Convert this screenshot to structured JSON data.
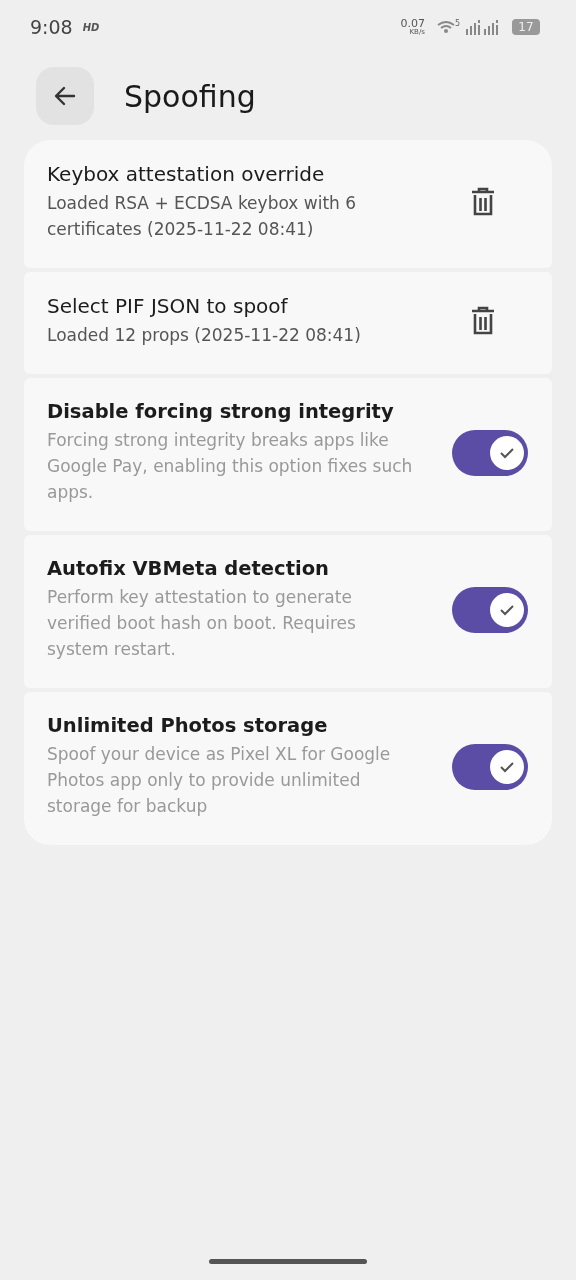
{
  "status_bar": {
    "time": "9:08",
    "hd": "HD",
    "speed": "0.07",
    "speed_unit": "KB/s",
    "wifi_band": "5",
    "battery": "17"
  },
  "header": {
    "title": "Spoofing"
  },
  "items": [
    {
      "kind": "file",
      "title": "Keybox attestation override",
      "description": "Loaded RSA + ECDSA keybox with 6 certificates (2025-11-22 08:41)"
    },
    {
      "kind": "file",
      "title": "Select PIF JSON to spoof",
      "description": "Loaded 12 props (2025-11-22 08:41)"
    },
    {
      "kind": "toggle",
      "title": "Disable forcing strong integrity",
      "description": "Forcing strong integrity breaks apps like Google Pay, enabling this option fixes such apps.",
      "on": true
    },
    {
      "kind": "toggle",
      "title": "Autofix VBMeta detection",
      "description": "Perform key attestation to generate verified boot hash on boot. Requires system restart.",
      "on": true
    },
    {
      "kind": "toggle",
      "title": "Unlimited Photos storage",
      "description": "Spoof your device as Pixel XL for Google Photos app only to provide unlimited storage for backup",
      "on": true
    }
  ]
}
